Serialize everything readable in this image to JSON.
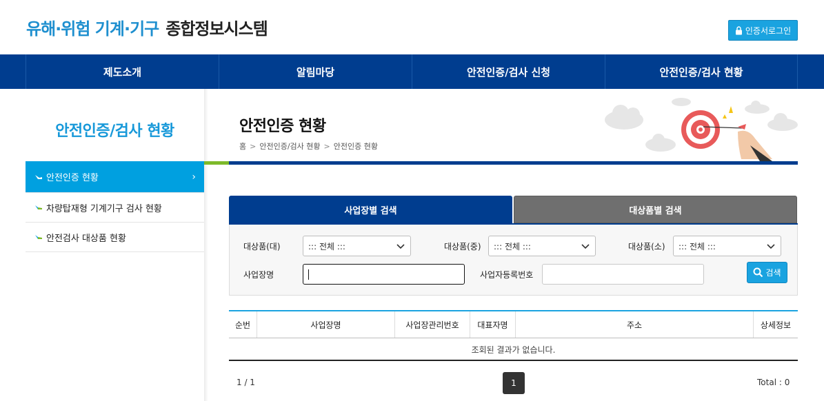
{
  "header": {
    "logo_part1": "유해·위험 기계·기구",
    "logo_part2": "종합정보시스템",
    "login_button": "인증서로그인"
  },
  "nav": {
    "items": [
      {
        "label": "제도소개"
      },
      {
        "label": "알림마당"
      },
      {
        "label": "안전인증/검사 신청"
      },
      {
        "label": "안전인증/검사 현황"
      }
    ]
  },
  "sidebar": {
    "title": "안전인증/검사 현황",
    "items": [
      {
        "label": "안전인증 현황",
        "active": true
      },
      {
        "label": "차량탑재형 기계기구 검사 현황",
        "active": false
      },
      {
        "label": "안전검사 대상품 현황",
        "active": false
      }
    ]
  },
  "page": {
    "title": "안전인증 현황",
    "breadcrumb": [
      "홈",
      "안전인증/검사 현황",
      "안전인증 현황"
    ]
  },
  "tabs": [
    {
      "label": "사업장별 검색",
      "active": true
    },
    {
      "label": "대상품별 검색",
      "active": false
    }
  ],
  "search": {
    "label_large": "대상품(대)",
    "label_medium": "대상품(중)",
    "label_small": "대상품(소)",
    "select_large": "::: 전체 :::",
    "select_medium": "::: 전체 :::",
    "select_small": "::: 전체 :::",
    "label_business_name": "사업장명",
    "label_reg_no": "사업자등록번호",
    "business_name_value": "",
    "reg_no_value": "",
    "search_button": "검색"
  },
  "table": {
    "columns": [
      "순번",
      "사업장명",
      "사업장관리번호",
      "대표자명",
      "주소",
      "상세정보"
    ],
    "empty_message": "조회된 결과가 없습니다."
  },
  "pagination": {
    "page_info": "1 / 1",
    "current_page": "1",
    "total": "Total : 0"
  },
  "colors": {
    "primary": "#003d8f",
    "accent": "#1aa3e0",
    "sidebar_title": "#1698d9",
    "inactive_tab": "#6f6f6f"
  }
}
